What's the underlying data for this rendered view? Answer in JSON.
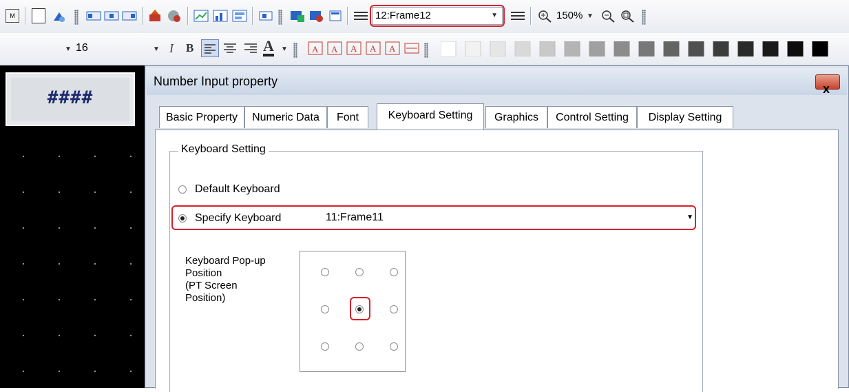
{
  "toolbar1": {
    "icons": [
      "macro-icon",
      "new-screen-icon",
      "scan-icon",
      "align-left-object-icon",
      "align-center-object-icon",
      "align-right-object-icon",
      "export-icon",
      "import-icon",
      "chart-icon",
      "chart2-icon",
      "chart3-icon",
      "frame-icon",
      "add-object-icon",
      "delete-object-icon",
      "screen-properties-icon"
    ],
    "frame_select": "12:Frame12",
    "zoom": "150%"
  },
  "toolbar2": {
    "font_size": "16"
  },
  "preview": {
    "text": "####"
  },
  "dialog": {
    "title": "Number Input property",
    "close_label": "x",
    "tabs": [
      "Basic Property",
      "Numeric Data",
      "Font",
      "Keyboard Setting",
      "Graphics",
      "Control Setting",
      "Display Setting"
    ],
    "active_tab": "Keyboard Setting",
    "group_title": "Keyboard Setting",
    "radio_default": "Default Keyboard",
    "radio_specify": "Specify Keyboard",
    "keyboard_value": "11:Frame11",
    "popup_label": [
      "Keyboard Pop-up",
      "Position",
      "(PT Screen",
      "Position)"
    ],
    "popup_selected": "middle-center"
  },
  "colors": {
    "highlight": "#d7202b",
    "canvas": "#000000"
  }
}
